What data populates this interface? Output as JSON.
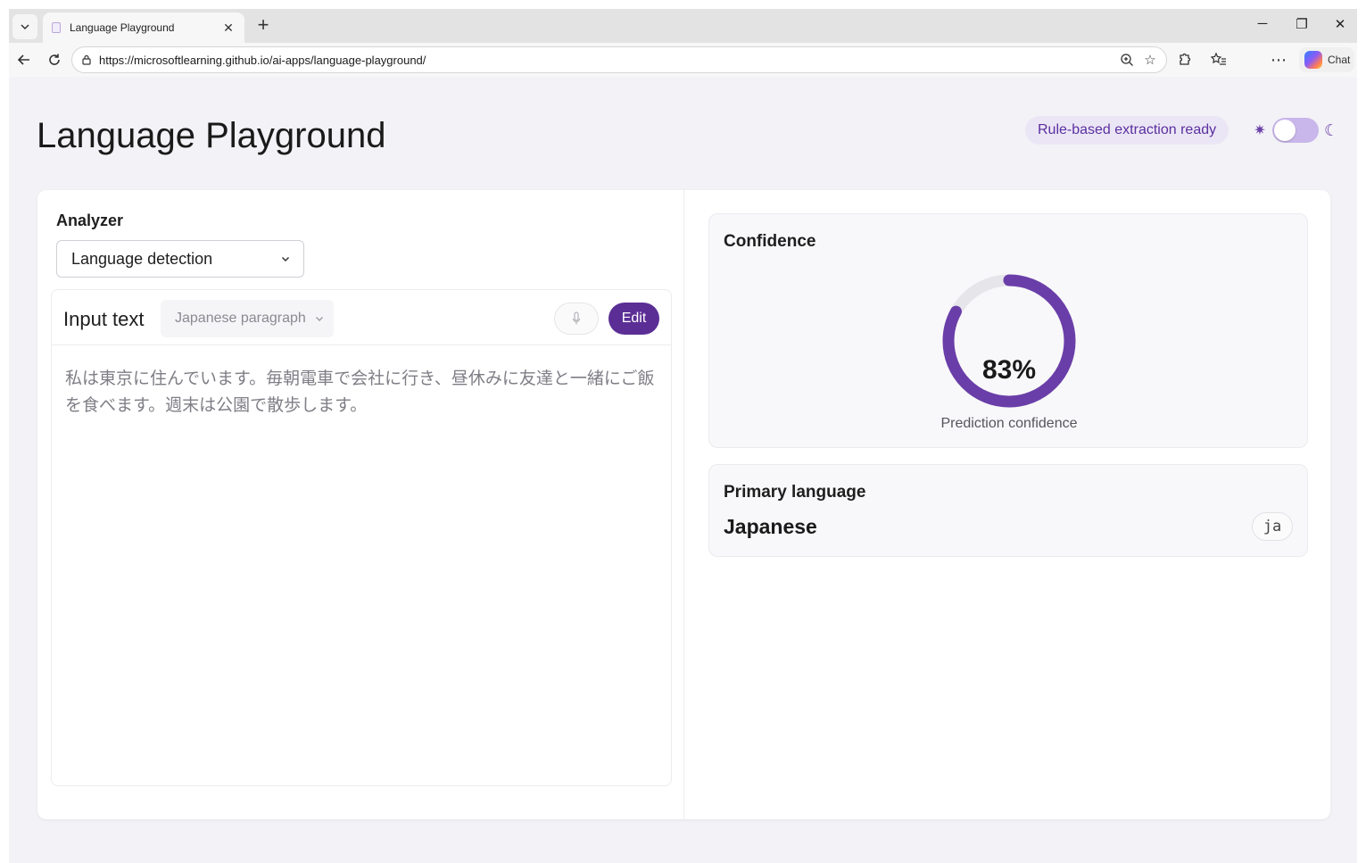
{
  "browser": {
    "tab_title": "Language Playground",
    "url": "https://microsoftlearning.github.io/ai-apps/language-playground/",
    "chat_label": "Chat"
  },
  "header": {
    "title": "Language Playground",
    "status": "Rule-based extraction ready",
    "theme_dark": false
  },
  "analyzer": {
    "label": "Analyzer",
    "selected": "Language detection"
  },
  "input": {
    "label": "Input text",
    "sample_selected": "Japanese paragraph",
    "edit_label": "Edit",
    "text": "私は東京に住んでいます。毎朝電車で会社に行き、昼休みに友達と一緒にご飯を食べます。週末は公園で散歩します。"
  },
  "confidence": {
    "title": "Confidence",
    "value": 0.83,
    "value_label": "83%",
    "caption": "Prediction confidence"
  },
  "primary_language": {
    "label": "Primary language",
    "name": "Japanese",
    "code": "ja"
  },
  "colors": {
    "accent": "#5b2e95",
    "ring_fill": "#6a3ea8",
    "ring_track": "#e6e6ea"
  },
  "icons": {
    "tab_menu": "chevron-down-icon",
    "back": "back-arrow-icon",
    "refresh": "refresh-icon",
    "lock": "lock-icon",
    "zoom": "zoom-icon",
    "favorite": "star-icon",
    "extensions": "extensions-icon",
    "collections": "favorites-list-icon",
    "more": "more-icon",
    "sun": "sun-icon",
    "moon": "moon-icon",
    "mic": "microphone-icon"
  }
}
